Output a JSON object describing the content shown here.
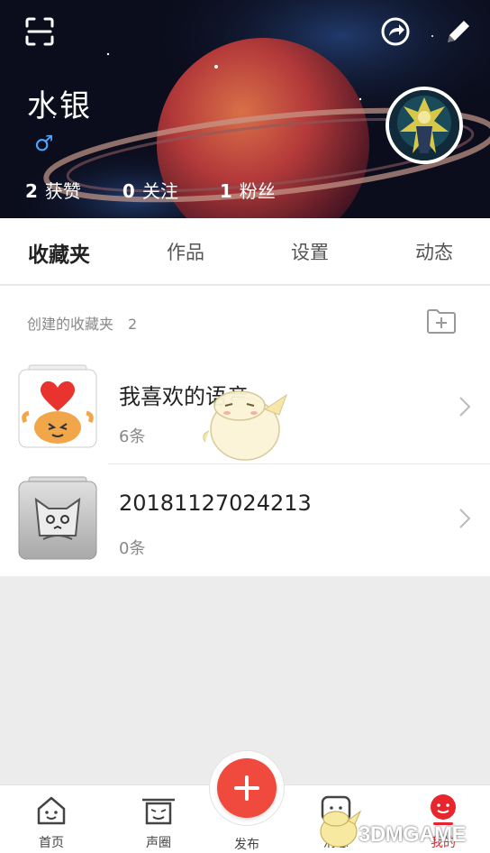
{
  "profile": {
    "username": "水银",
    "gender_symbol": "♂",
    "stats": [
      {
        "count": "2",
        "label": "获赞"
      },
      {
        "count": "0",
        "label": "关注"
      },
      {
        "count": "1",
        "label": "粉丝"
      }
    ]
  },
  "tabs": [
    "收藏夹",
    "作品",
    "设置",
    "动态"
  ],
  "folders": {
    "header_label": "创建的收藏夹",
    "header_count": "2",
    "items": [
      {
        "title": "我喜欢的语音",
        "subtitle": "6条"
      },
      {
        "title": "20181127024213",
        "subtitle": "0条"
      }
    ]
  },
  "nav": {
    "home": "首页",
    "circle": "声圈",
    "publish": "发布",
    "messages": "消息",
    "mine": "我的"
  },
  "watermark": "3DMGAME",
  "colors": {
    "accent": "#e8262e",
    "publish": "#f04a3e",
    "gender": "#4aa6ff"
  }
}
